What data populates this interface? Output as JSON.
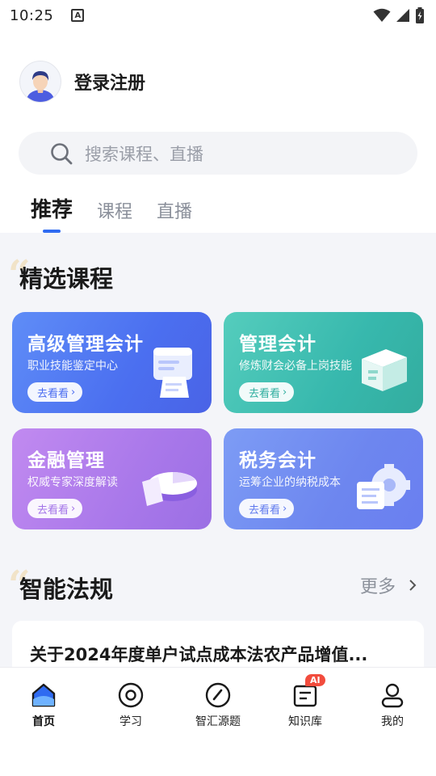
{
  "status_bar": {
    "time": "10:25",
    "notification_icon": "a-box-icon",
    "icons": [
      "wifi-icon",
      "signal-icon",
      "battery-icon"
    ]
  },
  "header": {
    "login_label": "登录注册",
    "avatar_icon": "user-avatar-icon"
  },
  "search": {
    "placeholder": "搜索课程、直播",
    "icon": "search-icon"
  },
  "tabs": [
    {
      "label": "推荐",
      "active": true
    },
    {
      "label": "课程",
      "active": false
    },
    {
      "label": "直播",
      "active": false
    }
  ],
  "featured": {
    "title": "精选课程",
    "cards": [
      {
        "title": "高级管理会计",
        "subtitle": "职业技能鉴定中心",
        "button": "去看看",
        "color": "#4b6ff0"
      },
      {
        "title": "管理会计",
        "subtitle": "修炼财会必备上岗技能",
        "button": "去看看",
        "color": "#37b8ad"
      },
      {
        "title": "金融管理",
        "subtitle": "权威专家深度解读",
        "button": "去看看",
        "color": "#a978ea"
      },
      {
        "title": "税务会计",
        "subtitle": "运筹企业的纳税成本",
        "button": "去看看",
        "color": "#6d86ef"
      }
    ]
  },
  "regulations": {
    "title": "智能法规",
    "more_label": "更多",
    "items": [
      {
        "title": "关于2024年度单户试点成本法农产品增值..."
      }
    ]
  },
  "bottom_nav": [
    {
      "label": "首页",
      "icon": "home-icon",
      "active": true
    },
    {
      "label": "学习",
      "icon": "study-icon",
      "active": false
    },
    {
      "label": "智汇源题",
      "icon": "compass-icon",
      "active": false
    },
    {
      "label": "知识库",
      "icon": "knowledge-icon",
      "active": false,
      "badge": "AI"
    },
    {
      "label": "我的",
      "icon": "profile-icon",
      "active": false
    }
  ],
  "colors": {
    "accent": "#2f6bf1",
    "badge": "#f24c3d",
    "content_bg": "#f4f5f9"
  }
}
